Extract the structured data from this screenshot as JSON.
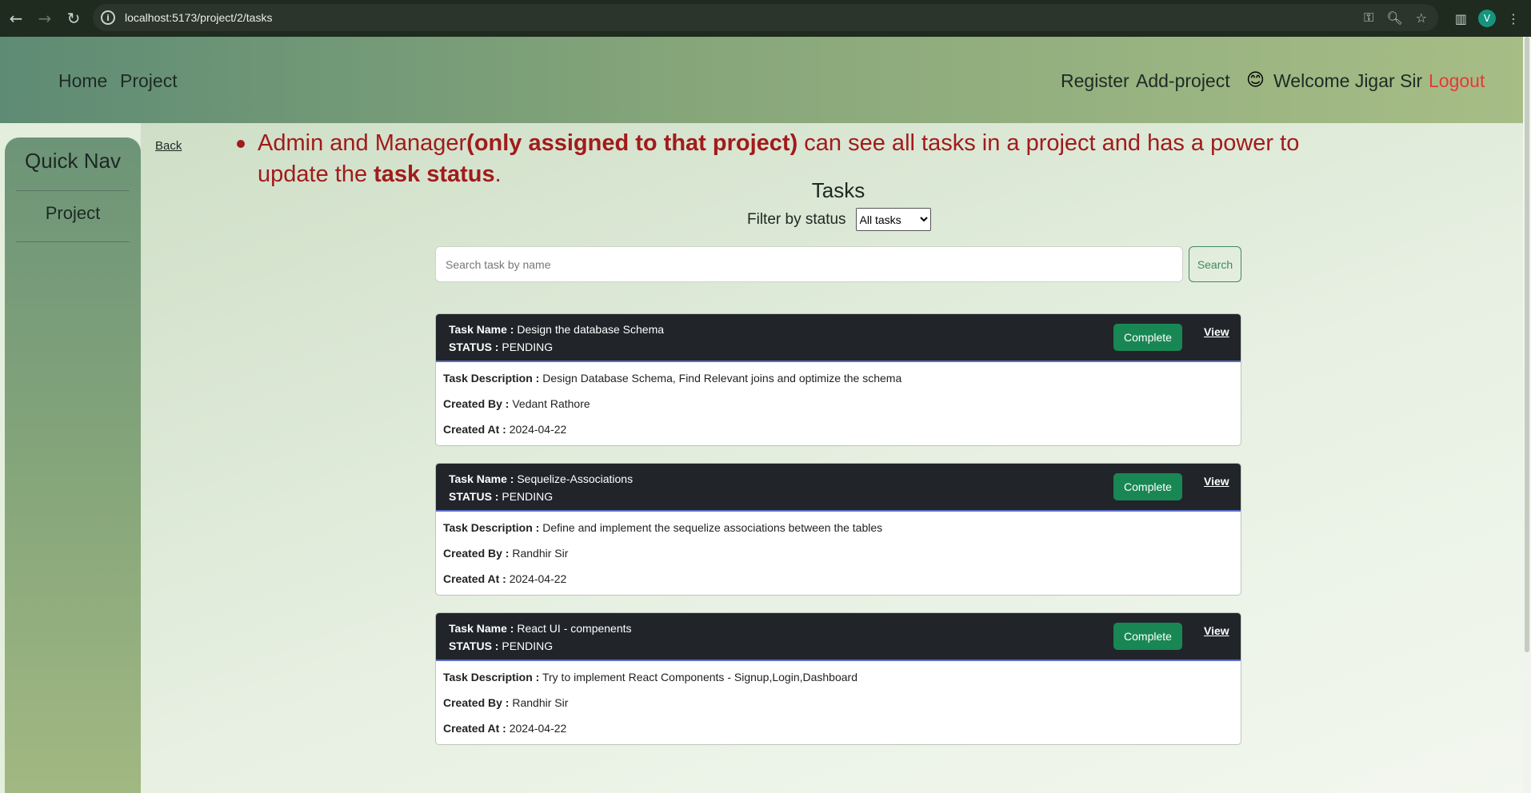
{
  "browser": {
    "url": "localhost:5173/project/2/tasks",
    "profile_initial": "V"
  },
  "header": {
    "home": "Home",
    "project": "Project",
    "register": "Register",
    "add_project": "Add-project",
    "welcome_emoji": "😊",
    "welcome": "Welcome Jigar Sir",
    "logout": "Logout"
  },
  "sidebar": {
    "title": "Quick Nav",
    "items": [
      {
        "label": "Project"
      }
    ]
  },
  "back": "Back",
  "notice": {
    "part1": "Admin and Manager",
    "bold1": "(only assigned to that project)",
    "part2": " can see all tasks in a project and has a power to update the ",
    "bold2": "task status",
    "part3": "."
  },
  "tasks_title": "Tasks",
  "filter": {
    "label": "Filter by status",
    "selected": "All tasks"
  },
  "search": {
    "placeholder": "Search task by name",
    "button": "Search"
  },
  "labels": {
    "task_name": "Task Name :",
    "status": "STATUS :",
    "description": "Task Description :",
    "created_by": "Created By :",
    "created_at": "Created At :",
    "complete": "Complete",
    "view": "View"
  },
  "tasks": [
    {
      "name": "Design the database Schema",
      "status": "PENDING",
      "description": "Design Database Schema, Find Relevant joins and optimize the schema",
      "created_by": "Vedant Rathore",
      "created_at": "2024-04-22"
    },
    {
      "name": "Sequelize-Associations",
      "status": "PENDING",
      "description": "Define and implement the sequelize associations between the tables",
      "created_by": "Randhir Sir",
      "created_at": "2024-04-22"
    },
    {
      "name": "React UI - compenents",
      "status": "PENDING",
      "description": "Try to implement React Components - Signup,Login,Dashboard",
      "created_by": "Randhir Sir",
      "created_at": "2024-04-22"
    }
  ],
  "colors": {
    "logout": "#e53935",
    "notice": "#a11b1b",
    "complete_button": "#198754",
    "card_header": "#212529"
  }
}
